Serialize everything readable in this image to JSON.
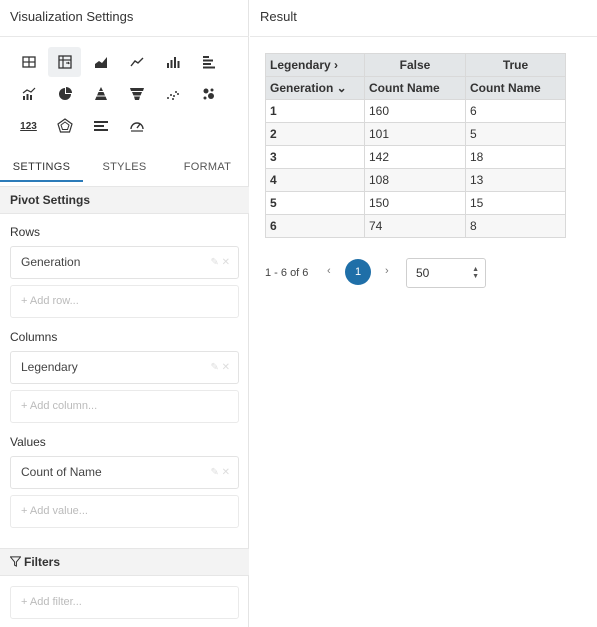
{
  "left_panel": {
    "title": "Visualization Settings",
    "viz_types": [
      "table-icon",
      "pivot-table-icon",
      "area-chart-icon",
      "line-chart-icon",
      "bar-chart-icon",
      "horizontal-bar-icon",
      "combo-chart-icon",
      "pie-chart-icon",
      "pyramid-icon",
      "funnel-icon",
      "scatter-icon",
      "bubble-icon",
      "number-icon",
      "radar-icon",
      "bullet-icon",
      "gauge-icon"
    ],
    "number_icon_text": "123",
    "tabs": [
      "SETTINGS",
      "STYLES",
      "FORMAT"
    ],
    "pivot_settings": {
      "title": "Pivot Settings",
      "rows_label": "Rows",
      "rows_value": "Generation",
      "rows_add": "+ Add row...",
      "columns_label": "Columns",
      "columns_value": "Legendary",
      "columns_add": "+ Add column...",
      "values_label": "Values",
      "values_value": "Count of Name",
      "values_add": "+ Add value..."
    },
    "filters": {
      "title": "Filters",
      "add": "+ Add filter..."
    }
  },
  "result": {
    "title": "Result",
    "table": {
      "col_field": "Legendary ›",
      "row_field": "Generation ⌄",
      "col_values": [
        "False",
        "True"
      ],
      "measure_labels": [
        "Count Name",
        "Count Name"
      ],
      "rows": [
        {
          "key": "1",
          "values": [
            "160",
            "6"
          ]
        },
        {
          "key": "2",
          "values": [
            "101",
            "5"
          ]
        },
        {
          "key": "3",
          "values": [
            "142",
            "18"
          ]
        },
        {
          "key": "4",
          "values": [
            "108",
            "13"
          ]
        },
        {
          "key": "5",
          "values": [
            "150",
            "15"
          ]
        },
        {
          "key": "6",
          "values": [
            "74",
            "8"
          ]
        }
      ]
    },
    "pager": {
      "count": "1 - 6 of 6",
      "prev": "‹",
      "page": "1",
      "next": "›",
      "page_size": "50"
    }
  },
  "colors": {
    "accent": "#2b7bb9",
    "page_active": "#1f6fa8",
    "header_bg": "#e3e6e8"
  }
}
